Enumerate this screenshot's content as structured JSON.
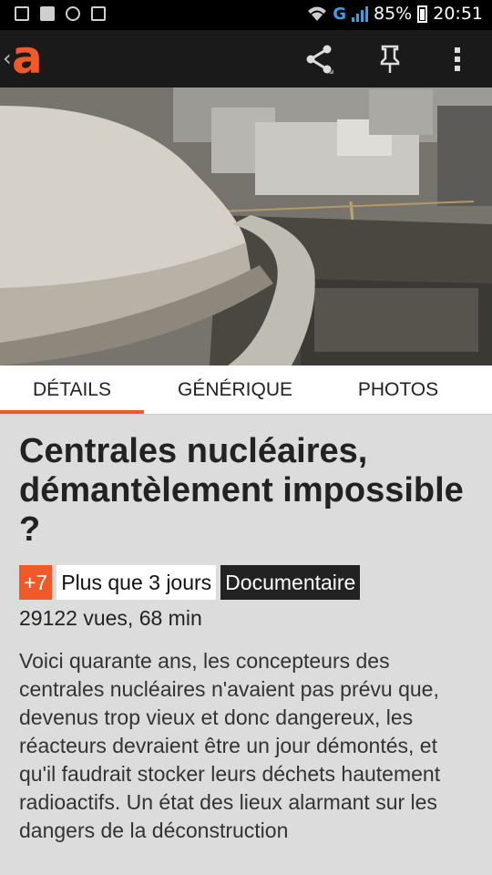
{
  "status_bar": {
    "network": "G",
    "battery": "85%",
    "time": "20:51"
  },
  "app_bar": {
    "logo": "a",
    "back": "‹"
  },
  "tabs": [
    {
      "label": "DÉTAILS",
      "selected": true
    },
    {
      "label": "GÉNÉRIQUE",
      "selected": false
    },
    {
      "label": "PHOTOS",
      "selected": false
    }
  ],
  "program": {
    "title": "Centrales nucléaires, démantèlement impossible ?",
    "age_rating": "+7",
    "availability": "Plus que 3 jours",
    "genre": "Documentaire",
    "stats": "29122 vues, 68 min",
    "description": "Voici quarante ans, les concepteurs des centrales nucléaires n'avaient pas prévu que, devenus trop vieux et donc dangereux, les réacteurs devraient être un jour démontés, et qu'il faudrait stocker leurs déchets hautement radioactifs. Un état des lieux alarmant sur les dangers de la déconstruction"
  },
  "colors": {
    "accent": "#f05a28",
    "app_bar": "#1a1a1a",
    "background": "#dcdcdc"
  }
}
